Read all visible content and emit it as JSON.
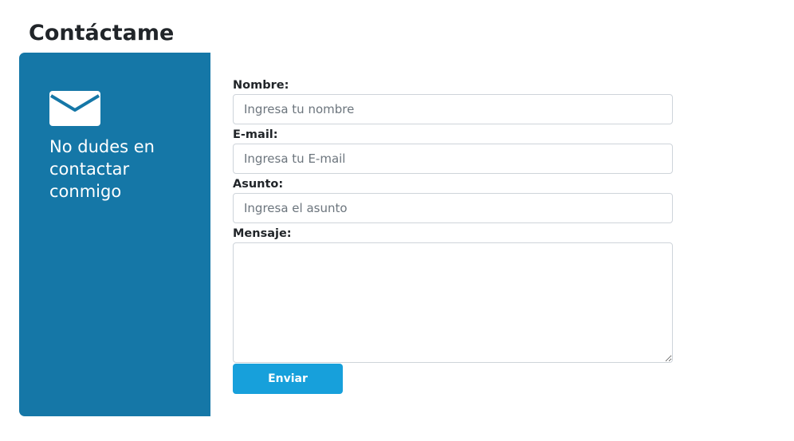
{
  "page": {
    "title": "Contáctame"
  },
  "sidebar": {
    "icon": "envelope-icon",
    "message": "No dudes en contactar conmigo",
    "background_color": "#1577a7"
  },
  "form": {
    "name": {
      "label": "Nombre:",
      "placeholder": "Ingresa tu nombre",
      "value": ""
    },
    "email": {
      "label": "E-mail:",
      "placeholder": "Ingresa tu E-mail",
      "value": ""
    },
    "subject": {
      "label": "Asunto:",
      "placeholder": "Ingresa el asunto",
      "value": ""
    },
    "message": {
      "label": "Mensaje:",
      "value": ""
    },
    "submit_label": "Enviar",
    "submit_color": "#17a0db"
  }
}
